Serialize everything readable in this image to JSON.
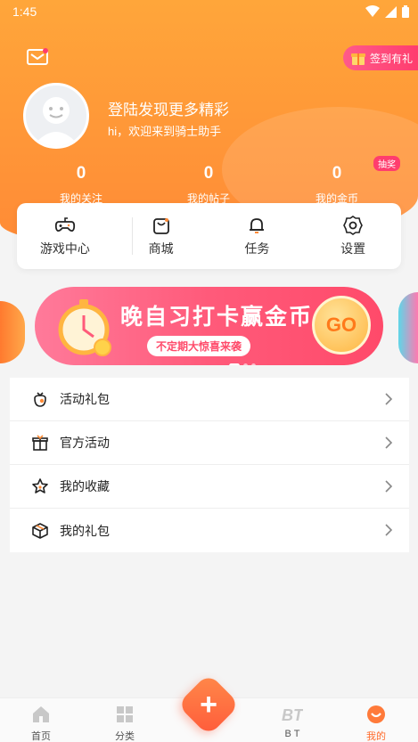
{
  "status": {
    "time": "1:45"
  },
  "header": {
    "signin_label": "签到有礼",
    "login_title": "登陆发现更多精彩",
    "login_subtitle": "hi，欢迎来到骑士助手"
  },
  "stats": [
    {
      "value": "0",
      "label": "我的关注"
    },
    {
      "value": "0",
      "label": "我的帖子"
    },
    {
      "value": "0",
      "label": "我的金币"
    }
  ],
  "lottery_badge": "抽奖",
  "quick": [
    {
      "label": "游戏中心",
      "icon": "gamepad-icon"
    },
    {
      "label": "商城",
      "icon": "shopping-bag-icon"
    },
    {
      "label": "任务",
      "icon": "bell-icon"
    },
    {
      "label": "设置",
      "icon": "gear-icon"
    }
  ],
  "banner": {
    "title": "晚自习打卡赢金币",
    "subtitle": "不定期大惊喜来袭",
    "go_label": "GO"
  },
  "menu": [
    {
      "label": "活动礼包",
      "icon": "gift-bag-icon"
    },
    {
      "label": "官方活动",
      "icon": "gift-box-icon"
    },
    {
      "label": "我的收藏",
      "icon": "star-icon"
    },
    {
      "label": "我的礼包",
      "icon": "package-icon"
    }
  ],
  "tabs": [
    {
      "label": "首页",
      "icon": "home-icon"
    },
    {
      "label": "分类",
      "icon": "grid-icon"
    },
    {
      "label": "B T",
      "icon": "bt-icon"
    },
    {
      "label": "我的",
      "icon": "profile-icon"
    }
  ],
  "colors": {
    "accent": "#ff8a36",
    "pink": "#ff3d6e",
    "active_tab": "#ff6a2a"
  }
}
